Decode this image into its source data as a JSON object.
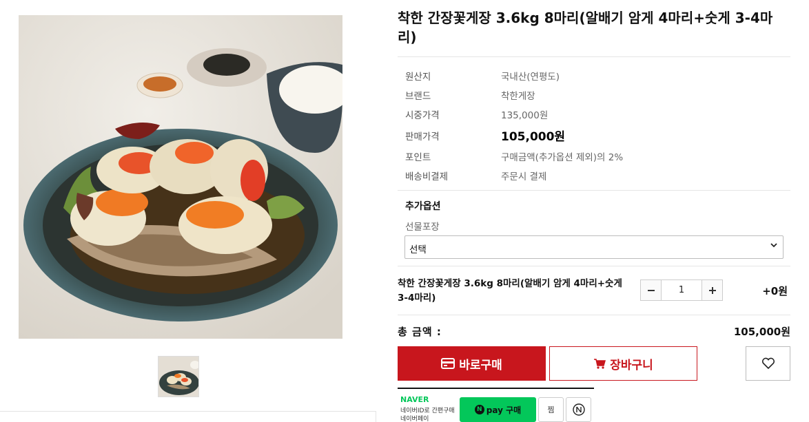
{
  "product": {
    "title": "착한 간장꽃게장 3.6kg 8마리(알배기 암게 4마리+숫게 3-4마리)",
    "specs": [
      {
        "label": "원산지",
        "value": "국내산(연평도)"
      },
      {
        "label": "브랜드",
        "value": "착한게장"
      },
      {
        "label": "시중가격",
        "value": "135,000원"
      },
      {
        "label": "판매가격",
        "value": "105,000원"
      },
      {
        "label": "포인트",
        "value": "구매금액(추가옵션 제외)의 2%"
      },
      {
        "label": "배송비결제",
        "value": "주문시 결제"
      }
    ]
  },
  "options": {
    "title": "추가옵션",
    "label": "선물포장",
    "selected": "선택"
  },
  "selected_item": {
    "name": "착한 간장꽃게장 3.6kg 8마리(알배기 암게 4마리+숫게 3-4마리)",
    "quantity": "1",
    "price": "+0원"
  },
  "total": {
    "label": "총 금액 :",
    "value": "105,000원"
  },
  "buttons": {
    "buy": "바로구매",
    "cart": "장바구니"
  },
  "naver": {
    "logo": "NAVER",
    "sub1": "네이버ID로 간편구매",
    "sub2": "네이버페이",
    "pay_label": "pay 구매",
    "pay_badge": "N",
    "zzim": "찜"
  },
  "colors": {
    "accent": "#c8161d",
    "naver_green": "#03c75a"
  }
}
